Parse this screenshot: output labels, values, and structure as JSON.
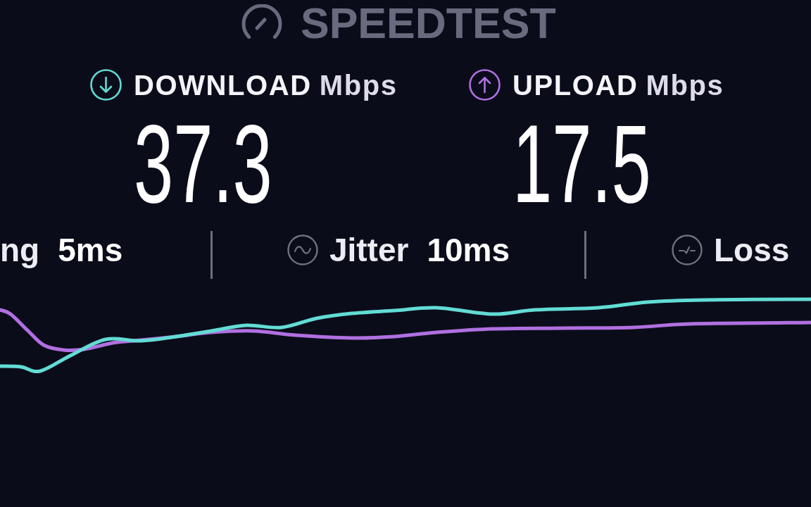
{
  "logo": {
    "text": "SPEEDTEST"
  },
  "speeds": [
    {
      "kind": "download",
      "label": "DOWNLOAD",
      "unit": "Mbps",
      "value": "37.3",
      "color": "#62dcd4"
    },
    {
      "kind": "upload",
      "label": "UPLOAD",
      "unit": "Mbps",
      "value": "17.5",
      "color": "#b070e0"
    }
  ],
  "metrics": [
    {
      "kind": "ping",
      "label": "ng",
      "value": "5ms"
    },
    {
      "kind": "jitter",
      "label": "Jitter",
      "value": "10ms"
    },
    {
      "kind": "loss",
      "label": "Loss"
    }
  ]
}
